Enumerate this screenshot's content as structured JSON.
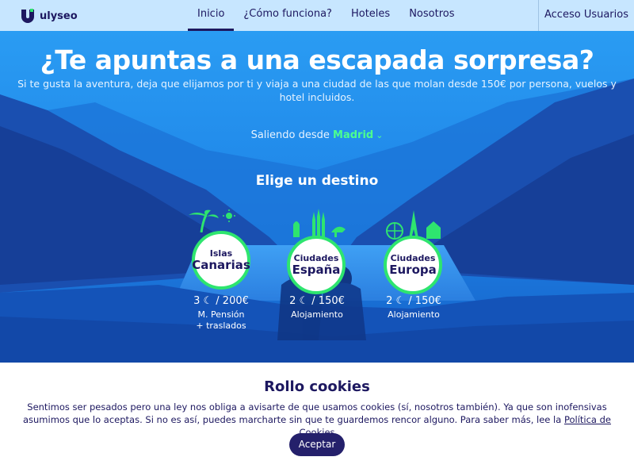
{
  "header": {
    "brand": "ulyseo",
    "nav": [
      {
        "label": "Inicio"
      },
      {
        "label": "¿Cómo funciona?"
      },
      {
        "label": "Hoteles"
      },
      {
        "label": "Nosotros"
      }
    ],
    "access": "Acceso Usuarios"
  },
  "hero": {
    "title": "¿Te apuntas a una escapada sorpresa?",
    "subtitle": "Si te gusta la aventura, deja que elijamos por ti y viaja a una ciudad de las que molan desde 150€ por persona, vuelos y hotel incluidos.",
    "leaving_prefix": "Saliendo desde",
    "leaving_city": "Madrid",
    "choose": "Elige un destino",
    "destinations": [
      {
        "line1": "Islas",
        "line2": "Canarias",
        "nights": "3",
        "price": "/ 200€",
        "note1": "M. Pensión",
        "note2": "+ traslados",
        "icon": "palm-tree-sun-icon"
      },
      {
        "line1": "Ciudades",
        "line2": "España",
        "nights": "2",
        "price": "/ 150€",
        "note1": "Alojamiento",
        "note2": "",
        "icon": "spain-landmarks-icon"
      },
      {
        "line1": "Ciudades",
        "line2": "Europa",
        "nights": "2",
        "price": "/ 150€",
        "note1": "Alojamiento",
        "note2": "",
        "icon": "europe-landmarks-icon"
      }
    ]
  },
  "cookies": {
    "title": "Rollo cookies",
    "text": "Sentimos ser pesados pero una ley nos obliga a avisarte de que usamos cookies (sí, nosotros también). Ya que son inofensivas asumimos que lo aceptas. Si no es así, puedes marcharte sin que te guardemos rencor alguno. Para saber más, lee la",
    "link": "Política de Cookies",
    "accept": "Aceptar"
  },
  "colors": {
    "navy": "#1d1860",
    "header_bg": "#c7e6ff",
    "hero_blue": "#1f7fe0",
    "accent_green": "#2ee56f",
    "button": "#24206b"
  }
}
